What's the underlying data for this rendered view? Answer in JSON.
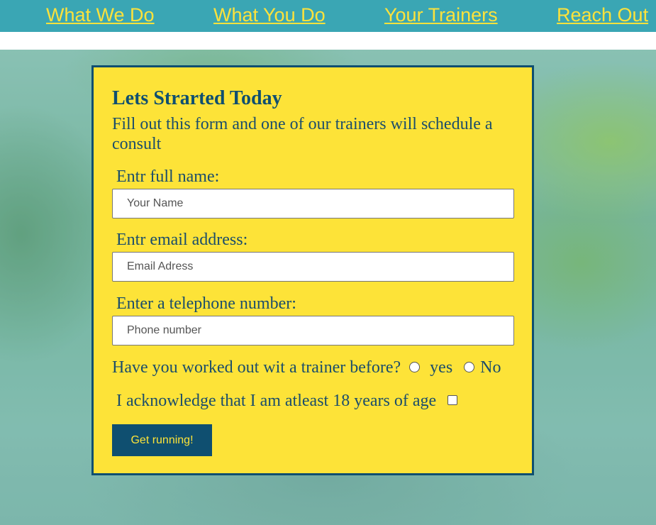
{
  "nav": {
    "items": [
      "What We Do",
      "What You Do",
      "Your Trainers",
      "Reach Out"
    ]
  },
  "form": {
    "title": "Lets Strarted Today",
    "subtitle": "Fill out this form and one of our trainers will schedule a consult",
    "name_label": "Entr full name:",
    "name_placeholder": "Your Name",
    "email_label": "Entr email address:",
    "email_placeholder": "Email Adress",
    "phone_label": "Enter a telephone number:",
    "phone_placeholder": "Phone number",
    "trainer_question": "Have you worked out wit a trainer before?",
    "option_yes": "yes",
    "option_no": "No",
    "age_ack": "I acknowledge that I am atleast 18 years of age",
    "submit_label": "Get running!"
  },
  "colors": {
    "nav_bg": "#3aa6b4",
    "nav_link": "#fde23b",
    "card_bg": "#fde338",
    "card_border": "#0f4f70",
    "button_bg": "#0f4f70"
  }
}
